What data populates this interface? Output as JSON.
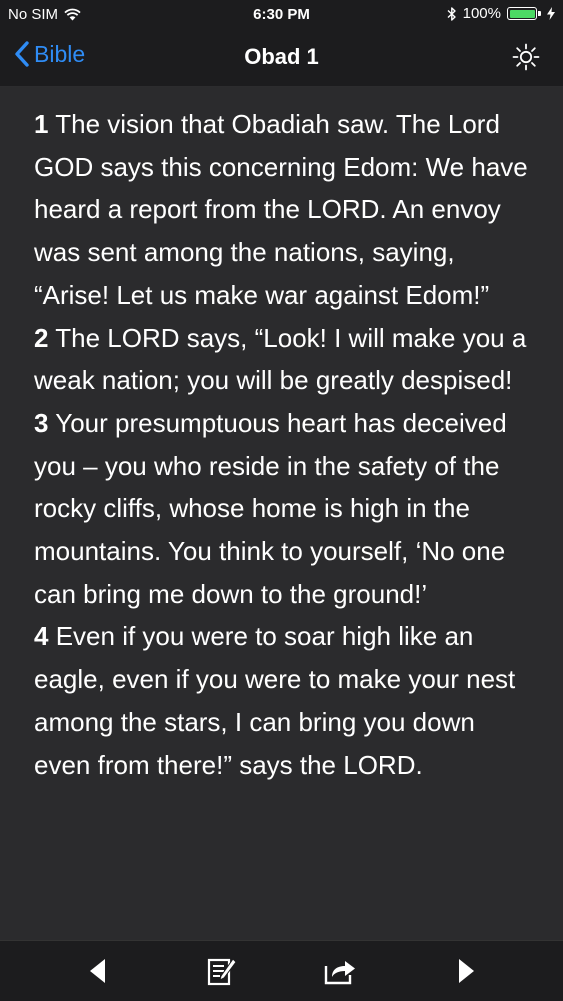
{
  "status_bar": {
    "carrier": "No SIM",
    "time": "6:30 PM",
    "battery_percent": "100%",
    "battery_level": 1.0,
    "battery_color": "#4cd964",
    "icons": [
      "wifi-icon",
      "bluetooth-icon",
      "battery-icon",
      "charging-bolt-icon"
    ]
  },
  "nav": {
    "back_label": "Bible",
    "title": "Obad 1",
    "accent_color": "#2f8cf5",
    "right_icon": "brightness-icon"
  },
  "verses": [
    {
      "num": "1",
      "text": "The vision that Obadiah saw. The Lord GOD says this concerning Edom: We have heard a report from the LORD. An envoy was sent among the nations, saying, “Arise! Let us make war against Edom!”"
    },
    {
      "num": "2",
      "text": "The LORD says, “Look! I will make you a weak nation; you will be greatly despised!"
    },
    {
      "num": "3",
      "text": "Your presumptuous heart has deceived you – you who reside in the safety of the rocky cliffs, whose home is high in the mountains. You think to yourself, ‘No one can bring me down to the ground!’"
    },
    {
      "num": "4",
      "text": "Even if you were to soar high like an eagle, even if you were to make your nest among the stars, I can bring you down even from there!” says the LORD."
    }
  ],
  "toolbar": {
    "icons": [
      "previous-chapter-icon",
      "notes-icon",
      "share-icon",
      "next-chapter-icon"
    ]
  }
}
